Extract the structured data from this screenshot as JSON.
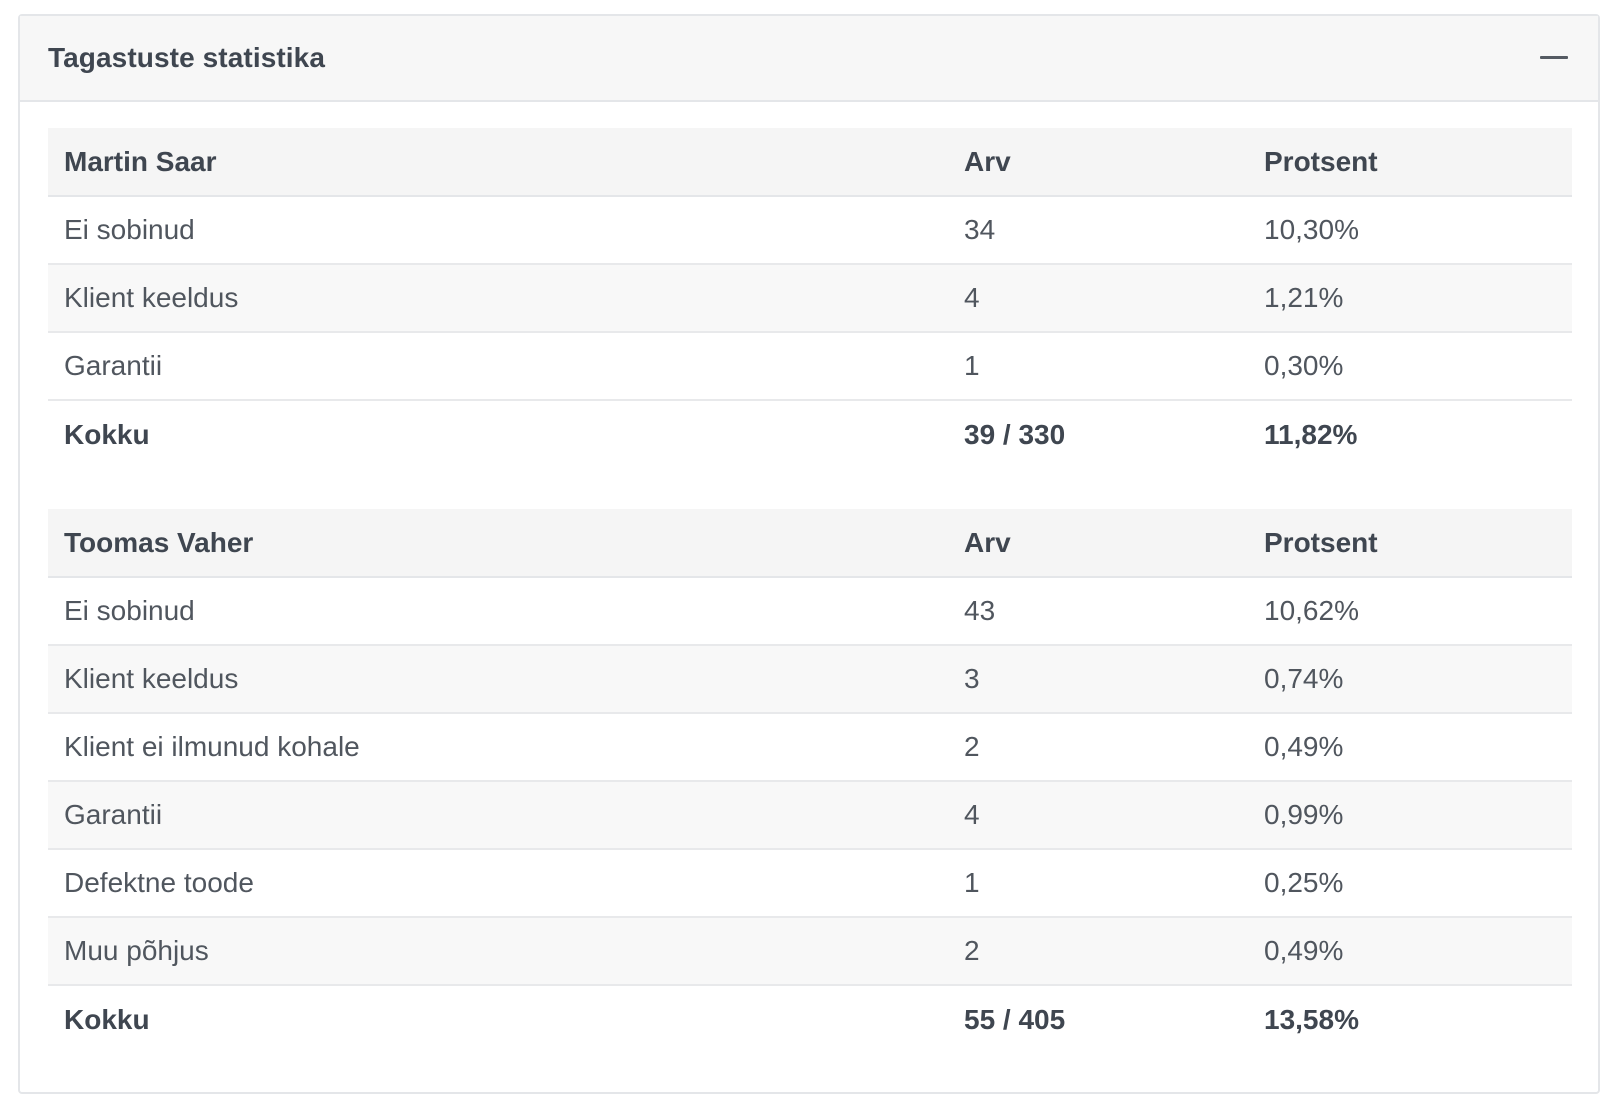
{
  "panel": {
    "title": "Tagastuste statistika",
    "collapse_icon": "minus-icon"
  },
  "tables": [
    {
      "header": {
        "name": "Martin Saar",
        "count": "Arv",
        "percent": "Protsent"
      },
      "rows": [
        {
          "reason": "Ei sobinud",
          "count": "34",
          "percent": "10,30%"
        },
        {
          "reason": "Klient keeldus",
          "count": "4",
          "percent": "1,21%"
        },
        {
          "reason": "Garantii",
          "count": "1",
          "percent": "0,30%"
        }
      ],
      "total": {
        "label": "Kokku",
        "count": "39 / 330",
        "percent": "11,82%"
      }
    },
    {
      "header": {
        "name": "Toomas Vaher",
        "count": "Arv",
        "percent": "Protsent"
      },
      "rows": [
        {
          "reason": "Ei sobinud",
          "count": "43",
          "percent": "10,62%"
        },
        {
          "reason": "Klient keeldus",
          "count": "3",
          "percent": "0,74%"
        },
        {
          "reason": "Klient ei ilmunud kohale",
          "count": "2",
          "percent": "0,49%"
        },
        {
          "reason": "Garantii",
          "count": "4",
          "percent": "0,99%"
        },
        {
          "reason": "Defektne toode",
          "count": "1",
          "percent": "0,25%"
        },
        {
          "reason": "Muu põhjus",
          "count": "2",
          "percent": "0,49%"
        }
      ],
      "total": {
        "label": "Kokku",
        "count": "55 / 405",
        "percent": "13,58%"
      }
    }
  ]
}
